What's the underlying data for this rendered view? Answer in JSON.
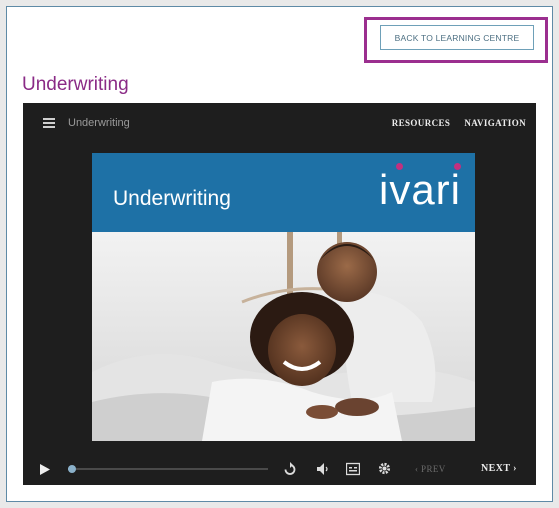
{
  "back_button": {
    "label": "BACK TO LEARNING CENTRE"
  },
  "page": {
    "title": "Underwriting"
  },
  "player": {
    "course_title": "Underwriting",
    "nav": {
      "resources": "RESOURCES",
      "navigation": "NAVIGATION"
    },
    "slide": {
      "title": "Underwriting",
      "logo_text": "ivari",
      "photo": "couple-lying-smiling-photo"
    },
    "controls": {
      "prev_label": "‹ PREV",
      "next_label": "NEXT ›",
      "progress": 0.02
    }
  },
  "colors": {
    "accent": "#8a2a86",
    "banner": "#1e71a6",
    "logo_dot": "#c2307f"
  }
}
